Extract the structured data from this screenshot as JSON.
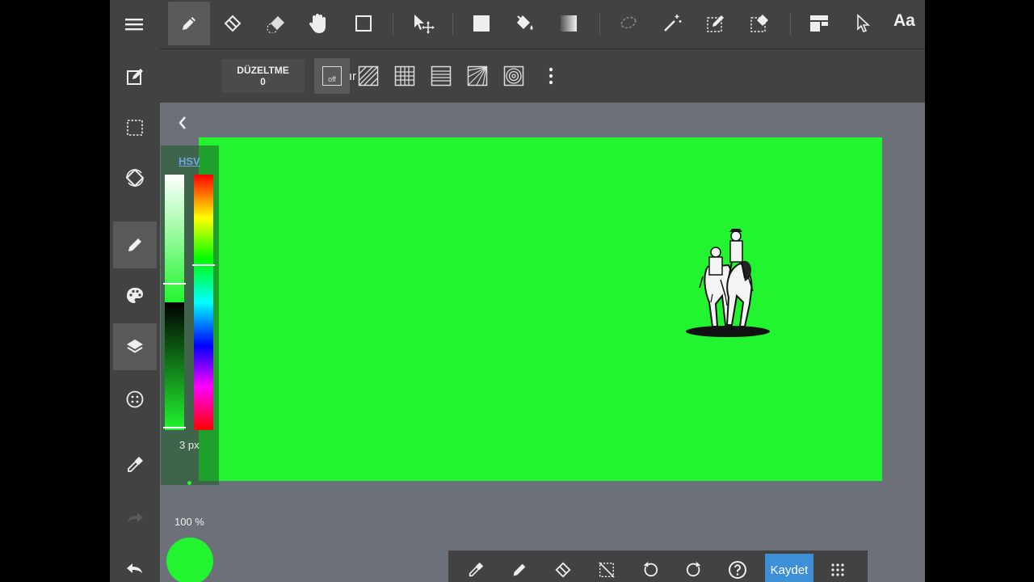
{
  "top_toolbar": {
    "tools": [
      "pen-icon",
      "eraser-icon",
      "blur-eraser-icon",
      "hand-icon",
      "rectangle-icon",
      "move-icon",
      "fill-rect-icon",
      "bucket-icon",
      "gradient-icon",
      "lasso-icon",
      "magic-wand-icon",
      "select-pen-icon",
      "select-eraser-icon",
      "layout-icon",
      "cursor-icon"
    ],
    "text_tool_label": "Aa"
  },
  "sub_toolbar": {
    "correction_label": "DÜZELTME",
    "correction_value": "0",
    "snap_label": "Sığdır",
    "snap_off_label": "off"
  },
  "color_panel": {
    "mode_label": "HSV",
    "brush_size": "3 px",
    "opacity": "100 %",
    "current_color": "#22f530"
  },
  "canvas": {
    "background_color": "#22f530"
  },
  "bottom_toolbar": {
    "save_label": "Kaydet"
  }
}
